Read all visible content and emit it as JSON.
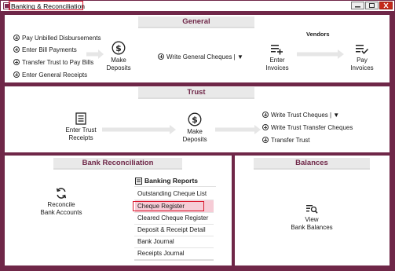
{
  "window": {
    "title": "Banking & Reconciliation",
    "controls": [
      "minimize",
      "maximize",
      "close"
    ]
  },
  "colors": {
    "frame": "#6f2748",
    "header_text": "#6f2748",
    "panel": "#ffffff",
    "tab_background": "#e9e9e9",
    "highlight_border": "#d9182d",
    "selected_row": "#f6ccd6",
    "arrow": "#e6e6e6"
  },
  "general": {
    "header": "General",
    "links": [
      "Pay Unbilled Disbursements",
      "Enter Bill Payments",
      "Transfer Trust to Pay Bills",
      "Enter General Receipts"
    ],
    "make_deposits": "Make\nDeposits",
    "write_cheques": "Write General Cheques | ▼",
    "vendors_label": "Vendors",
    "enter_invoices": "Enter\nInvoices",
    "pay_invoices": "Pay\nInvoices"
  },
  "trust": {
    "header": "Trust",
    "enter_receipts": "Enter Trust\nReceipts",
    "make_deposits": "Make\nDeposits",
    "links": [
      "Write Trust Cheques | ▼",
      "Write Trust Transfer Cheques",
      "Transfer Trust"
    ]
  },
  "bank_reconciliation": {
    "header": "Bank Reconciliation",
    "reconcile": "Reconcile\nBank Accounts",
    "reports_title": "Banking Reports",
    "reports": [
      "Outstanding Cheque List",
      "Cheque Register",
      "Cleared Cheque Register",
      "Deposit & Receipt Detail",
      "Bank Journal",
      "Receipts Journal"
    ],
    "selected_index": 1
  },
  "balances": {
    "header": "Balances",
    "view": "View\nBank Balances"
  },
  "icons": {
    "app": "app-icon",
    "make_deposits": "dollar-circle-icon",
    "enter_invoices": "list-plus-icon",
    "pay_invoices": "list-check-icon",
    "enter_trust_receipts": "receipt-icon",
    "reconcile": "refresh-arrows-icon",
    "banking_reports": "report-icon",
    "view_balances": "list-search-icon",
    "bullets": "plus-circle-icon"
  }
}
